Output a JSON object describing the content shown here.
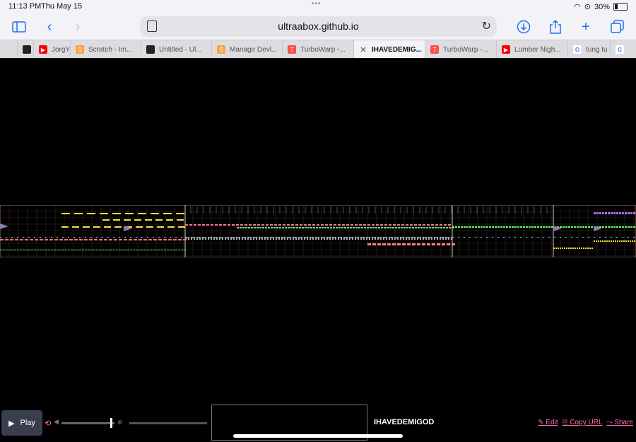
{
  "status": {
    "time": "11:13 PM",
    "date": "Thu May 15",
    "battery": "30%"
  },
  "browser": {
    "url": "ultraabox.github.io",
    "tabs": [
      {
        "label": "",
        "icon": "ultrabox-icon",
        "color": "#222"
      },
      {
        "label": "JorgY",
        "icon": "youtube-icon",
        "color": "#ff0000"
      },
      {
        "label": "Scratch - Im...",
        "icon": "scratch-icon",
        "color": "#f7a540"
      },
      {
        "label": "Untitled - Ul...",
        "icon": "ultrabox-icon",
        "color": "#222"
      },
      {
        "label": "Manage Devl...",
        "icon": "scratch-icon",
        "color": "#f7a540"
      },
      {
        "label": "TurboWarp -...",
        "icon": "turbowarp-icon",
        "color": "#ff4c4c"
      },
      {
        "label": "IHAVEDEMIG...",
        "icon": "close-icon",
        "color": "#888",
        "active": true
      },
      {
        "label": "TurboWarp -...",
        "icon": "turbowarp-icon",
        "color": "#ff4c4c"
      },
      {
        "label": "Lumber Nigh...",
        "icon": "youtube-icon",
        "color": "#ff0000"
      },
      {
        "label": "tung tu",
        "icon": "google-icon",
        "color": "#4285f4"
      },
      {
        "label": "",
        "icon": "google-icon",
        "color": "#4285f4"
      }
    ]
  },
  "player": {
    "play_label": "Play",
    "song_title": "IHAVEDEMIGOD",
    "links": {
      "edit": "✎ Edit",
      "copy": "⎘ Copy URL",
      "share": "⤳ Share"
    },
    "volume": 0.95
  },
  "colors": {
    "accent": "#ff6fb5",
    "grid": "#9b6a55"
  }
}
